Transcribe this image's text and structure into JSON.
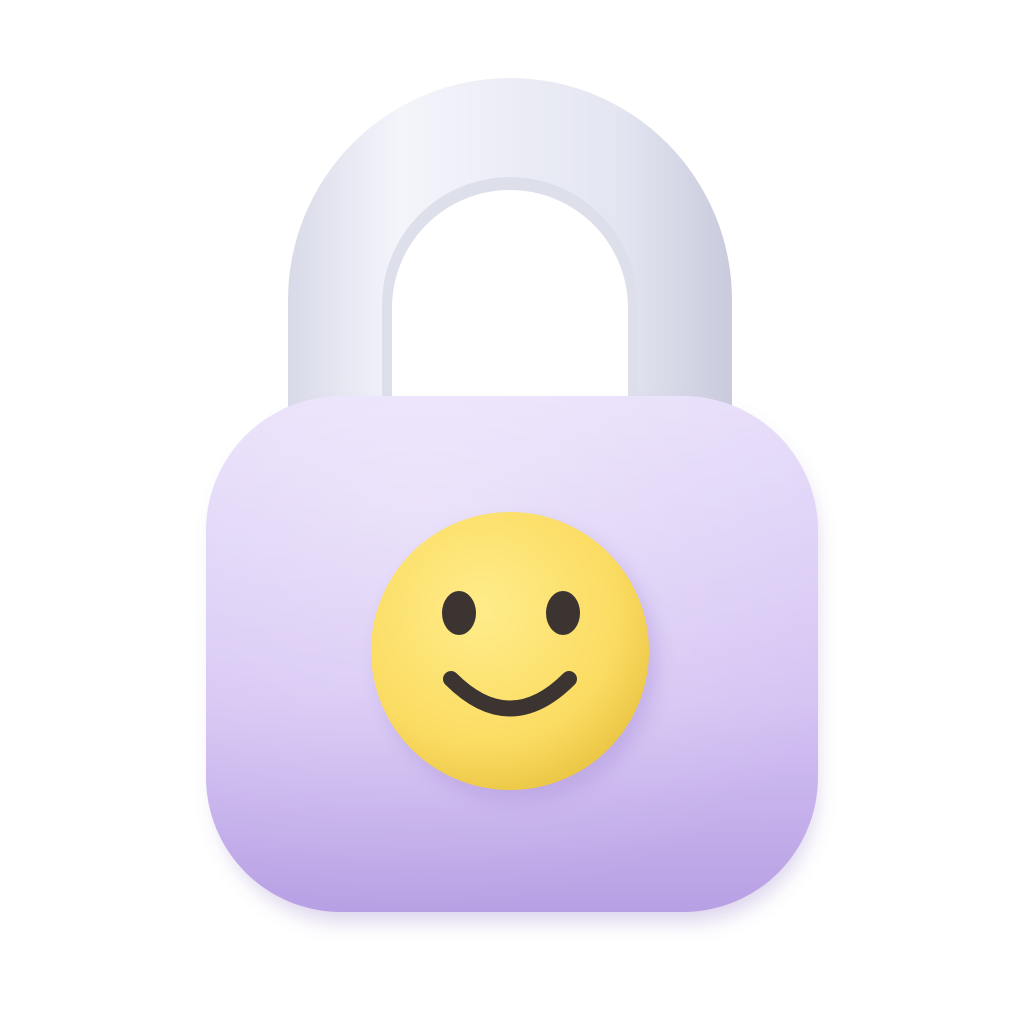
{
  "illustration": {
    "icon": "padlock-smiley-icon",
    "colors": {
      "background": "#ffffff",
      "shackle_light": "#f4f5fb",
      "shackle_mid": "#e3e5f1",
      "shackle_shadow": "#c9cbdd",
      "body_light": "#e6dcfa",
      "body_mid": "#d4c2f3",
      "body_shadow": "#b7a0e4",
      "face_light": "#ffec8a",
      "face_mid": "#fbdc62",
      "face_shadow": "#e6bf3c",
      "features": "#3c3430"
    }
  }
}
